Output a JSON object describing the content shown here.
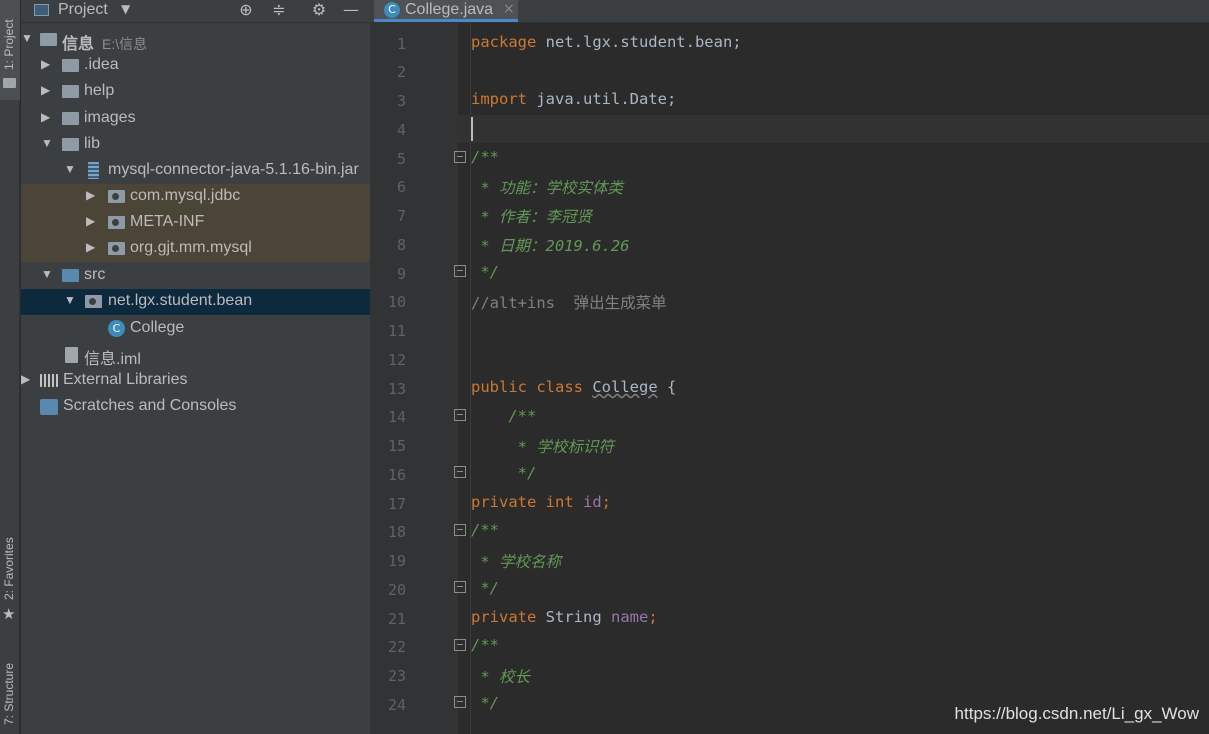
{
  "sidebar": {
    "project_tab": "1: Project",
    "favorites_tab": "2: Favorites",
    "structure_tab": "7: Structure"
  },
  "project_panel": {
    "title": "Project",
    "tree": [
      {
        "label": "信息",
        "path": "E:\\信息",
        "icon": "folder-icon",
        "arrow": "▼"
      },
      {
        "label": ".idea",
        "icon": "folder-icon",
        "arrow": "▶"
      },
      {
        "label": "help",
        "icon": "folder-icon",
        "arrow": "▶"
      },
      {
        "label": "images",
        "icon": "folder-icon",
        "arrow": "▶"
      },
      {
        "label": "lib",
        "icon": "folder-icon",
        "arrow": "▼"
      },
      {
        "label": "mysql-connector-java-5.1.16-bin.jar",
        "icon": "jar-icon",
        "arrow": "▼"
      },
      {
        "label": "com.mysql.jdbc",
        "icon": "package-icon",
        "arrow": "▶"
      },
      {
        "label": "META-INF",
        "icon": "package-icon",
        "arrow": "▶"
      },
      {
        "label": "org.gjt.mm.mysql",
        "icon": "package-icon",
        "arrow": "▶"
      },
      {
        "label": "src",
        "icon": "source-folder-icon",
        "arrow": "▼"
      },
      {
        "label": "net.lgx.student.bean",
        "icon": "package-icon",
        "arrow": "▼"
      },
      {
        "label": "College",
        "icon": "class-icon",
        "badge": "C"
      },
      {
        "label": "信息.iml",
        "icon": "module-file-icon"
      },
      {
        "label": "External Libraries",
        "icon": "libraries-icon",
        "arrow": "▶"
      },
      {
        "label": "Scratches and Consoles",
        "icon": "scratches-icon"
      }
    ]
  },
  "editor": {
    "tab_label": "College.java",
    "tab_badge": "C",
    "tab_close": "×",
    "line_numbers": [
      "1",
      "2",
      "3",
      "4",
      "5",
      "6",
      "7",
      "8",
      "9",
      "10",
      "11",
      "12",
      "13",
      "14",
      "15",
      "16",
      "17",
      "18",
      "19",
      "20",
      "21",
      "22",
      "23",
      "24"
    ],
    "code": {
      "l1_kw": "package",
      "l1_rest": " net.lgx.student.bean;",
      "l3_kw": "import",
      "l3_rest": " java.util.Date;",
      "l5": "/**",
      "l6": " * 功能：学校实体类",
      "l7": " * 作者：李冠贤",
      "l8": " * 日期：2019.6.26",
      "l9": " */",
      "l10": "//alt+ins  弹出生成菜单",
      "l13_kw": "public class",
      "l13_name": "College",
      "l13_rest": " {",
      "l14": "    /**",
      "l15": "     * 学校标识符",
      "l16": "     */",
      "l17_kw": "private int",
      "l17_field": "id",
      "l17_rest": ";",
      "l18": "/**",
      "l19": " * 学校名称",
      "l20": " */",
      "l21_kw": "private",
      "l21_type": " String ",
      "l21_field": "name",
      "l21_rest": ";",
      "l22": "/**",
      "l23": " * 校长",
      "l24": " */"
    }
  },
  "watermark": "https://blog.csdn.net/Li_gx_Wow",
  "colors": {
    "keyword": "#cc7832",
    "doc_comment": "#629755",
    "line_comment": "#808080",
    "field": "#9876aa",
    "selection": "#0d293e",
    "library_highlight": "#4a4536"
  }
}
